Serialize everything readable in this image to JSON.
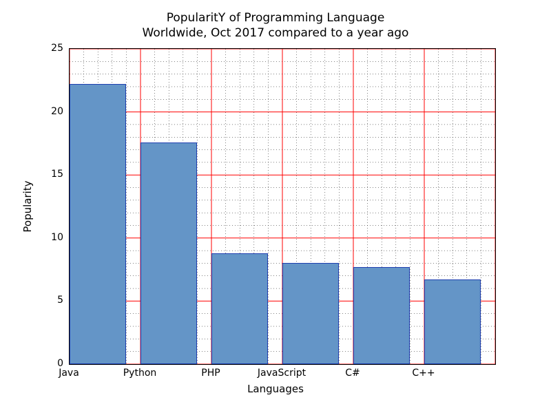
{
  "chart_data": {
    "type": "bar",
    "categories": [
      "Java",
      "Python",
      "PHP",
      "JavaScript",
      "C#",
      "C++"
    ],
    "values": [
      22.2,
      17.6,
      8.8,
      8.0,
      7.7,
      6.7
    ],
    "title_line1": "PopularitY of Programming Language",
    "title_line2": "Worldwide, Oct 2017 compared to a year ago",
    "xlabel": "Languages",
    "ylabel": "Popularity",
    "ylim": [
      0,
      25
    ],
    "yticks": [
      0,
      5,
      10,
      15,
      20,
      25
    ],
    "grid": true,
    "bar_color": "#6495c7",
    "bar_edge": "#1f3fb0",
    "grid_color": "#ff0000",
    "minor_color": "#000000"
  }
}
